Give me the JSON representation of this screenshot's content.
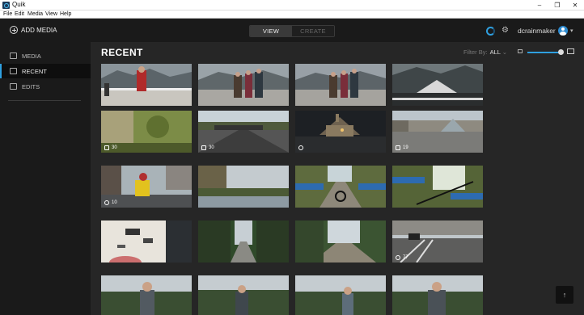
{
  "window": {
    "title": "Quik",
    "minimize": "–",
    "maximize": "❐",
    "close": "✕"
  },
  "menu": [
    "File",
    "Edit",
    "Media",
    "View",
    "Help"
  ],
  "toolbar": {
    "add_media": "ADD MEDIA",
    "view_tab": "VIEW",
    "create_tab": "CREATE",
    "username": "dcrainmaker"
  },
  "sidebar": {
    "items": [
      {
        "label": "MEDIA"
      },
      {
        "label": "RECENT"
      },
      {
        "label": "EDITS"
      }
    ]
  },
  "content": {
    "heading": "RECENT",
    "filter_label": "Filter By:",
    "filter_value": "ALL",
    "scroll_top": "↑"
  },
  "colors": {
    "accent": "#2fa0e0",
    "background": "#262626",
    "sidebar": "#1a1a1a"
  },
  "thumbnails": [
    {
      "badge": ""
    },
    {
      "badge": ""
    },
    {
      "badge": ""
    },
    {
      "badge": ""
    },
    {
      "badge": "30"
    },
    {
      "badge": "30"
    },
    {
      "badge": ""
    },
    {
      "badge": "19"
    },
    {
      "badge": "10"
    },
    {
      "badge": ""
    },
    {
      "badge": ""
    },
    {
      "badge": ""
    },
    {
      "badge": ""
    },
    {
      "badge": ""
    },
    {
      "badge": ""
    },
    {
      "badge": "77"
    },
    {
      "badge": ""
    },
    {
      "badge": ""
    },
    {
      "badge": ""
    },
    {
      "badge": ""
    }
  ]
}
